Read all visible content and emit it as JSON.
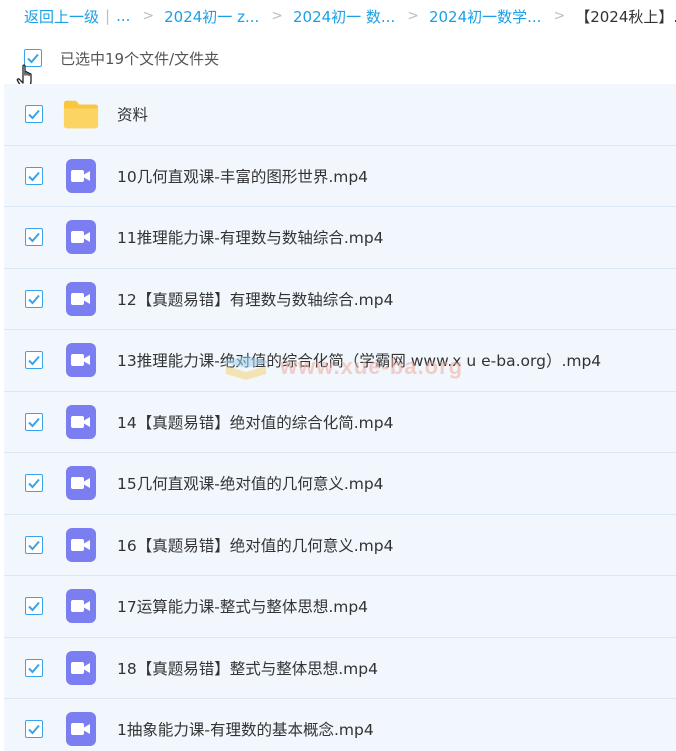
{
  "breadcrumb": {
    "back": "返回上一级",
    "sep": "|",
    "ellipsis": "...",
    "items": [
      "2024初一 z...",
      "2024初一 数...",
      "2024初一数学...",
      "【2024秋上】..."
    ]
  },
  "selection": {
    "text": "已选中19个文件/文件夹",
    "checked": true
  },
  "files": [
    {
      "name": "资料",
      "type": "folder",
      "icon": "folder-icon"
    },
    {
      "name": "10几何直观课-丰富的图形世界.mp4",
      "type": "video",
      "icon": "video-icon"
    },
    {
      "name": "11推理能力课-有理数与数轴综合.mp4",
      "type": "video",
      "icon": "video-icon"
    },
    {
      "name": "12【真题易错】有理数与数轴综合.mp4",
      "type": "video",
      "icon": "video-icon"
    },
    {
      "name": "13推理能力课-绝对值的综合化简（学霸网 www.x u e-ba.org）.mp4",
      "type": "video",
      "icon": "video-icon"
    },
    {
      "name": "14【真题易错】绝对值的综合化简.mp4",
      "type": "video",
      "icon": "video-icon"
    },
    {
      "name": "15几何直观课-绝对值的几何意义.mp4",
      "type": "video",
      "icon": "video-icon"
    },
    {
      "name": "16【真题易错】绝对值的几何意义.mp4",
      "type": "video",
      "icon": "video-icon"
    },
    {
      "name": "17运算能力课-整式与整体思想.mp4",
      "type": "video",
      "icon": "video-icon"
    },
    {
      "name": "18【真题易错】整式与整体思想.mp4",
      "type": "video",
      "icon": "video-icon"
    },
    {
      "name": "1抽象能力课-有理数的基本概念.mp4",
      "type": "video",
      "icon": "video-icon"
    }
  ],
  "watermark": "www.xue-ba.org",
  "colors": {
    "link": "#1aa0e8",
    "checkbox": "#3aa3ea",
    "row_bg": "#f1f7fd",
    "video_icon": "#7b7ef0",
    "folder_icon": "#f9c63f"
  }
}
